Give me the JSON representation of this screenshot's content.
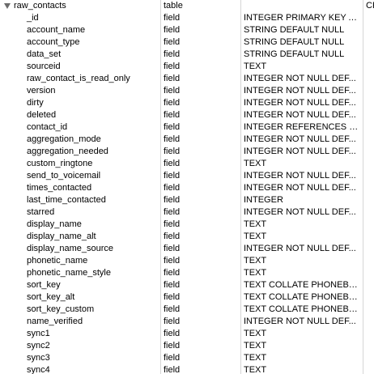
{
  "table": {
    "root": {
      "name": "raw_contacts",
      "type": "table",
      "extra_header": "CR"
    },
    "fields": [
      {
        "name": "_id",
        "type": "field",
        "definition": "INTEGER PRIMARY KEY A..."
      },
      {
        "name": "account_name",
        "type": "field",
        "definition": "STRING DEFAULT NULL"
      },
      {
        "name": "account_type",
        "type": "field",
        "definition": "STRING DEFAULT NULL"
      },
      {
        "name": "data_set",
        "type": "field",
        "definition": "STRING DEFAULT NULL"
      },
      {
        "name": "sourceid",
        "type": "field",
        "definition": "TEXT"
      },
      {
        "name": "raw_contact_is_read_only",
        "type": "field",
        "definition": "INTEGER NOT NULL DEF..."
      },
      {
        "name": "version",
        "type": "field",
        "definition": "INTEGER NOT NULL DEF..."
      },
      {
        "name": "dirty",
        "type": "field",
        "definition": "INTEGER NOT NULL DEF..."
      },
      {
        "name": "deleted",
        "type": "field",
        "definition": "INTEGER NOT NULL DEF..."
      },
      {
        "name": "contact_id",
        "type": "field",
        "definition": "INTEGER REFERENCES co..."
      },
      {
        "name": "aggregation_mode",
        "type": "field",
        "definition": "INTEGER NOT NULL DEF..."
      },
      {
        "name": "aggregation_needed",
        "type": "field",
        "definition": "INTEGER NOT NULL DEF..."
      },
      {
        "name": "custom_ringtone",
        "type": "field",
        "definition": "TEXT"
      },
      {
        "name": "send_to_voicemail",
        "type": "field",
        "definition": "INTEGER NOT NULL DEF..."
      },
      {
        "name": "times_contacted",
        "type": "field",
        "definition": "INTEGER NOT NULL DEF..."
      },
      {
        "name": "last_time_contacted",
        "type": "field",
        "definition": "INTEGER"
      },
      {
        "name": "starred",
        "type": "field",
        "definition": "INTEGER NOT NULL DEF..."
      },
      {
        "name": "display_name",
        "type": "field",
        "definition": "TEXT"
      },
      {
        "name": "display_name_alt",
        "type": "field",
        "definition": "TEXT"
      },
      {
        "name": "display_name_source",
        "type": "field",
        "definition": "INTEGER NOT NULL DEF..."
      },
      {
        "name": "phonetic_name",
        "type": "field",
        "definition": "TEXT"
      },
      {
        "name": "phonetic_name_style",
        "type": "field",
        "definition": "TEXT"
      },
      {
        "name": "sort_key",
        "type": "field",
        "definition": "TEXT COLLATE PHONEBOOK"
      },
      {
        "name": "sort_key_alt",
        "type": "field",
        "definition": "TEXT COLLATE PHONEBOOK"
      },
      {
        "name": "sort_key_custom",
        "type": "field",
        "definition": "TEXT COLLATE PHONEBOOK"
      },
      {
        "name": "name_verified",
        "type": "field",
        "definition": "INTEGER NOT NULL DEF..."
      },
      {
        "name": "sync1",
        "type": "field",
        "definition": "TEXT"
      },
      {
        "name": "sync2",
        "type": "field",
        "definition": "TEXT"
      },
      {
        "name": "sync3",
        "type": "field",
        "definition": "TEXT"
      },
      {
        "name": "sync4",
        "type": "field",
        "definition": "TEXT"
      }
    ]
  },
  "colors": {
    "row_alt": "#f2f5fa",
    "column_divider": "#d6d6d6",
    "disclosure": "#6b6b6b"
  }
}
